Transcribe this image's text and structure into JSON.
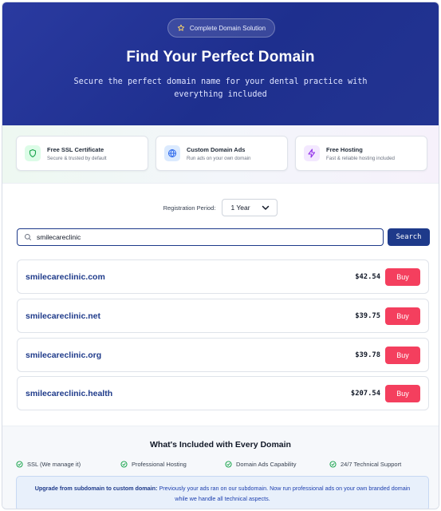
{
  "hero": {
    "badge": "Complete Domain Solution",
    "title": "Find Your Perfect Domain",
    "subtitle": "Secure the perfect domain name for your dental practice with everything included"
  },
  "features": [
    {
      "title": "Free SSL Certificate",
      "desc": "Secure & trusted by default",
      "icon": "shield-icon",
      "color": "#16a34a",
      "bg": "#dcfce7"
    },
    {
      "title": "Custom Domain Ads",
      "desc": "Run ads on your own domain",
      "icon": "globe-icon",
      "color": "#2563eb",
      "bg": "#dbeafe"
    },
    {
      "title": "Free Hosting",
      "desc": "Fast & reliable hosting included",
      "icon": "lightning-icon",
      "color": "#9333ea",
      "bg": "#f3e8ff"
    }
  ],
  "registration": {
    "label": "Registration Period:",
    "selected": "1 Year"
  },
  "search": {
    "value": "smilecareclinic",
    "button": "Search"
  },
  "results": [
    {
      "domain": "smilecareclinic.com",
      "price": "$42.54",
      "action": "Buy"
    },
    {
      "domain": "smilecareclinic.net",
      "price": "$39.75",
      "action": "Buy"
    },
    {
      "domain": "smilecareclinic.org",
      "price": "$39.78",
      "action": "Buy"
    },
    {
      "domain": "smilecareclinic.health",
      "price": "$207.54",
      "action": "Buy"
    }
  ],
  "included": {
    "title": "What's Included with Every Domain",
    "items": [
      "SSL (We manage it)",
      "Professional Hosting",
      "Domain Ads Capability",
      "24/7 Technical Support"
    ],
    "note_strong": "Upgrade from subdomain to custom domain:",
    "note_text": "Previously your ads ran on our subdomain. Now run professional ads on your own branded domain while we handle all technical aspects."
  },
  "colors": {
    "primary": "#1e3a8a",
    "buy": "#f43f5e",
    "check": "#16a34a"
  }
}
